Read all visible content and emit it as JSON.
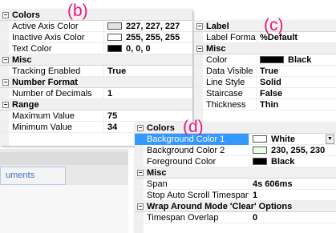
{
  "labels": {
    "b": "(b)",
    "c": "(c)",
    "d": "(d)"
  },
  "background_window": {
    "tab_label": "uments"
  },
  "panel_b": {
    "cats": {
      "colors": "Colors",
      "misc": "Misc",
      "number_format": "Number Format",
      "range": "Range"
    },
    "rows": {
      "active_axis_color": {
        "name": "Active Axis Color",
        "value": "227, 227, 227",
        "color": "#e3e3e3"
      },
      "inactive_axis_color": {
        "name": "Inactive Axis Color",
        "value": "255, 255, 255",
        "color": "#ffffff"
      },
      "text_color": {
        "name": "Text Color",
        "value": "0, 0, 0",
        "color": "#000000"
      },
      "tracking_enabled": {
        "name": "Tracking Enabled",
        "value": "True"
      },
      "number_of_decimals": {
        "name": "Number of Decimals",
        "value": "1"
      },
      "maximum_value": {
        "name": "Maximum Value",
        "value": "75"
      },
      "minimum_value": {
        "name": "Minimum Value",
        "value": "34"
      }
    }
  },
  "panel_c": {
    "cats": {
      "label": "Label",
      "misc": "Misc"
    },
    "rows": {
      "label_format": {
        "name": "Label Format",
        "value": "%Default"
      },
      "color": {
        "name": "Color",
        "value": "Black",
        "color": "#000000"
      },
      "data_visible": {
        "name": "Data Visible",
        "value": "True"
      },
      "line_style": {
        "name": "Line Style",
        "value": "Solid"
      },
      "staircase": {
        "name": "Staircase",
        "value": "False"
      },
      "thickness": {
        "name": "Thickness",
        "value": "Thin"
      }
    }
  },
  "panel_d": {
    "cats": {
      "colors": "Colors",
      "misc": "Misc",
      "wrap": "Wrap Around Mode 'Clear' Options"
    },
    "rows": {
      "background_color_1": {
        "name": "Background Color 1",
        "value": "White",
        "color": "#ffffff"
      },
      "background_color_2": {
        "name": "Background Color 2",
        "value": "230, 255, 230",
        "color": "#e6ffe6"
      },
      "foreground_color": {
        "name": "Foreground Color",
        "value": "Black",
        "color": "#000000"
      },
      "span": {
        "name": "Span",
        "value": "4s 606ms"
      },
      "stop_auto_scroll_timespan": {
        "name": "Stop Auto Scroll Timespan",
        "value": "1"
      },
      "timespan_overlap": {
        "name": "Timespan Overlap",
        "value": "0"
      }
    }
  },
  "colors": {
    "selection": "#3399ff",
    "label_accent": "#e8177c",
    "category_bg": "#f0f0f0"
  }
}
